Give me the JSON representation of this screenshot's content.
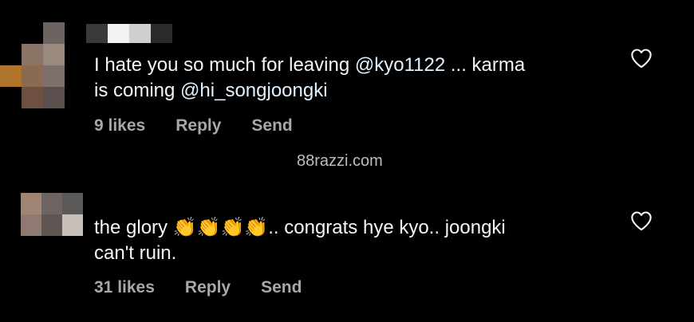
{
  "watermark": "88razzi.com",
  "comments": [
    {
      "text_part1": "I hate you so much for leaving ",
      "mention1": "@kyo1122",
      "text_part2": " ... karma\nis coming ",
      "mention2": "@hi_songjoongki",
      "likes": "9 likes",
      "reply": "Reply",
      "send": "Send",
      "heart_icon": "heart-outline-icon"
    },
    {
      "text_part1": "the glory ",
      "emoji": "👏👏👏👏",
      "text_part2": ".. congrats hye kyo.. joongki\ncan't ruin.",
      "likes": "31 likes",
      "reply": "Reply",
      "send": "Send",
      "heart_icon": "heart-outline-icon"
    }
  ],
  "colors": {
    "background": "#000000",
    "text": "#f5f5f5",
    "mention": "#e0f1ff",
    "meta": "#a8a8a8"
  }
}
